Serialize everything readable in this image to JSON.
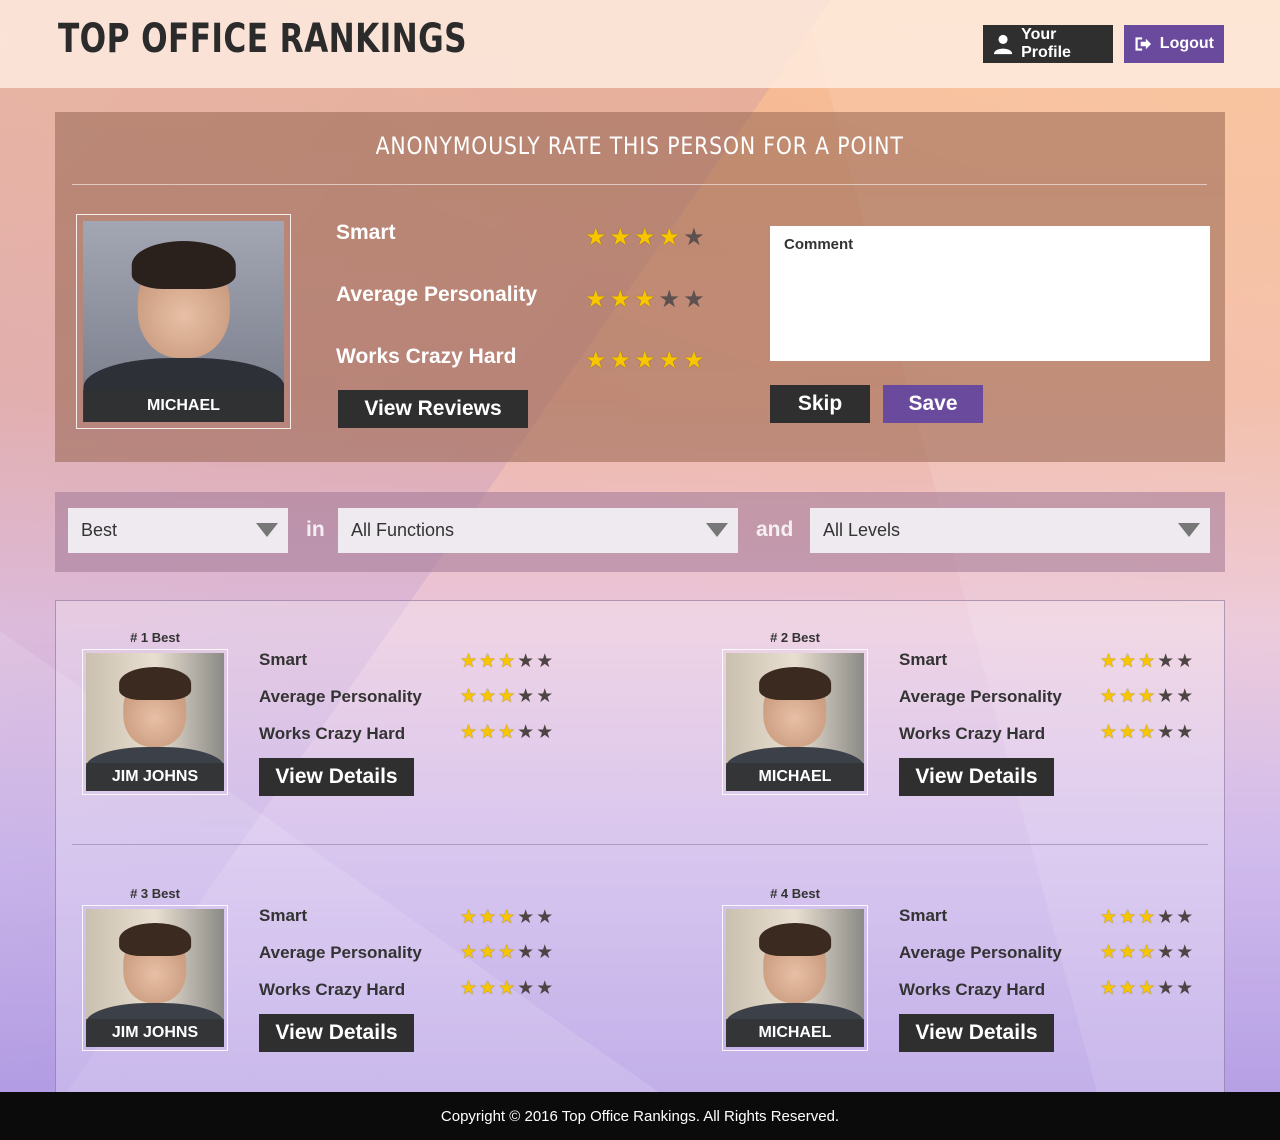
{
  "header": {
    "title": "TOP OFFICE RANKINGS",
    "profile_label": "Your Profile",
    "logout_label": "Logout"
  },
  "rate": {
    "title": "ANONYMOUSLY RATE THIS PERSON FOR A POINT",
    "person_name": "MICHAEL",
    "criteria": [
      {
        "label": "Smart",
        "stars": 4
      },
      {
        "label": "Average Personality",
        "stars": 3
      },
      {
        "label": "Works Crazy Hard",
        "stars": 5
      }
    ],
    "max_stars": 5,
    "view_reviews_label": "View Reviews",
    "comment_placeholder": "Comment",
    "skip_label": "Skip",
    "save_label": "Save"
  },
  "filter": {
    "sort_value": "Best",
    "word_in": "in",
    "function_value": "All Functions",
    "word_and": "and",
    "level_value": "All Levels"
  },
  "rankings": [
    {
      "rank_label": "# 1 Best",
      "name": "JIM JOHNS",
      "scores": [
        3,
        3,
        3
      ],
      "details_label": "View Details"
    },
    {
      "rank_label": "# 2 Best",
      "name": "MICHAEL",
      "scores": [
        3,
        3,
        3
      ],
      "details_label": "View Details"
    },
    {
      "rank_label": "# 3 Best",
      "name": "JIM JOHNS",
      "scores": [
        3,
        3,
        3
      ],
      "details_label": "View Details"
    },
    {
      "rank_label": "# 4 Best",
      "name": "MICHAEL",
      "scores": [
        3,
        3,
        3
      ],
      "details_label": "View Details"
    }
  ],
  "ranking_criteria": [
    "Smart",
    "Average Personality",
    "Works Crazy Hard"
  ],
  "footer": {
    "copyright": "Copyright © 2016 Top Office Rankings. All Rights Reserved."
  },
  "colors": {
    "dark_button": "#2f2f2f",
    "accent_purple": "#6a4a9c",
    "star_on": "#f7c600",
    "star_off": "#5e5050"
  }
}
